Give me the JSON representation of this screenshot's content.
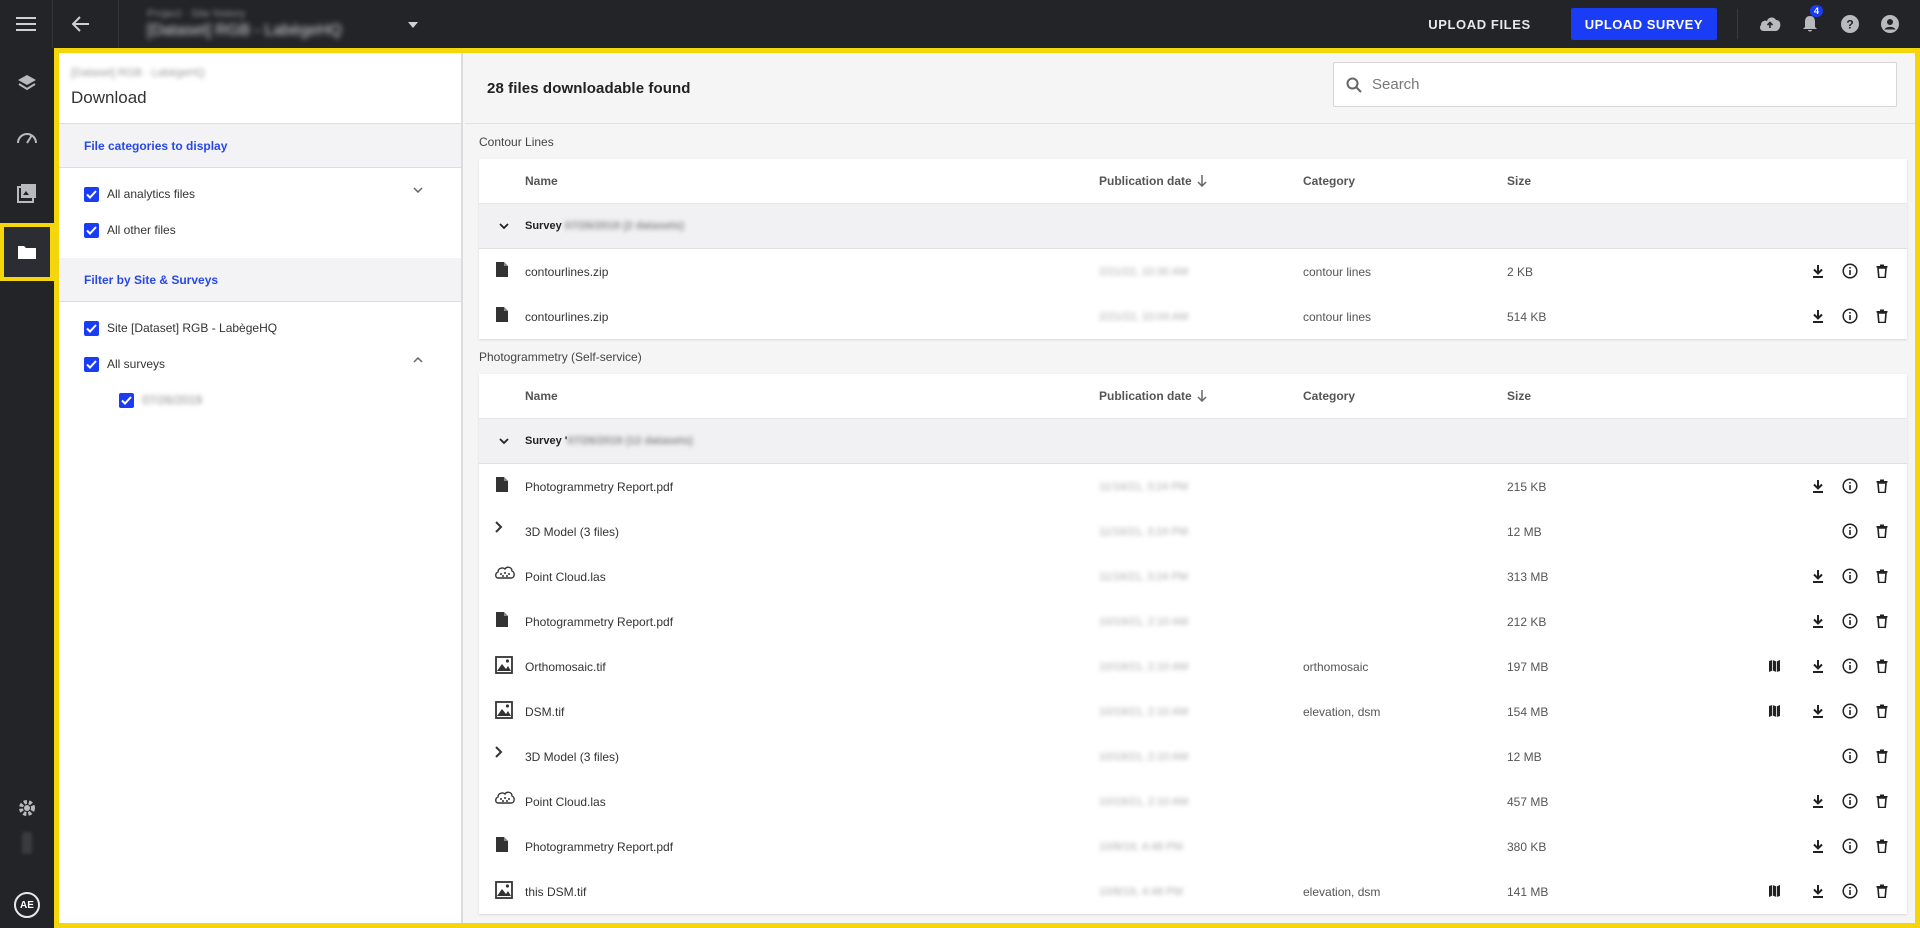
{
  "topbar": {
    "project_sub": "Project · Site history",
    "project_name": "[Dataset] RGB - LabègeHQ",
    "upload_files": "UPLOAD FILES",
    "upload_survey": "UPLOAD SURVEY",
    "notification_count": "4"
  },
  "filters": {
    "breadcrumb": "[Dataset] RGB · LabègeHQ",
    "title": "Download",
    "categories_title": "File categories to display",
    "all_analytics": "All analytics files",
    "all_other": "All other files",
    "site_title": "Filter by Site & Surveys",
    "site_label": "Site [Dataset] RGB - LabègeHQ",
    "all_surveys": "All surveys",
    "survey_date": "07/26/2019"
  },
  "content": {
    "count_label": "28 files downloadable found",
    "search_placeholder": "Search",
    "columns": {
      "name": "Name",
      "publication": "Publication date",
      "category": "Category",
      "size": "Size"
    }
  },
  "sections": [
    {
      "title": "Contour Lines",
      "group_label": "Survey",
      "group_detail": "07/26/2019 (2 datasets)",
      "rows": [
        {
          "name": "contourlines.zip",
          "date": "2/21/22, 10:30 AM",
          "category": "contour lines",
          "size": "2 KB",
          "icon": "file-icon"
        },
        {
          "name": "contourlines.zip",
          "date": "2/21/22, 10:04 AM",
          "category": "contour lines",
          "size": "514 KB",
          "icon": "file-icon"
        }
      ]
    },
    {
      "title": "Photogrammetry (Self-service)",
      "group_label": "Survey '",
      "group_detail": "07/26/2019 (12 datasets)",
      "rows": [
        {
          "name": "Photogrammetry Report.pdf",
          "date": "11/16/21, 3:24 PM",
          "category": "",
          "size": "215 KB",
          "icon": "file-icon"
        },
        {
          "name": "3D Model (3 files)",
          "date": "11/16/21, 3:24 PM",
          "category": "",
          "size": "12 MB",
          "icon": "chevron-right-icon"
        },
        {
          "name": "Point Cloud.las",
          "date": "11/16/21, 3:24 PM",
          "category": "",
          "size": "313 MB",
          "icon": "point-cloud-icon"
        },
        {
          "name": "Photogrammetry Report.pdf",
          "date": "10/19/21, 2:10 AM",
          "category": "",
          "size": "212 KB",
          "icon": "file-icon"
        },
        {
          "name": "Orthomosaic.tif",
          "date": "10/19/21, 2:10 AM",
          "category": "orthomosaic",
          "size": "197 MB",
          "icon": "raster-icon"
        },
        {
          "name": "DSM.tif",
          "date": "10/19/21, 2:10 AM",
          "category": "elevation, dsm",
          "size": "154 MB",
          "icon": "raster-icon"
        },
        {
          "name": "3D Model (3 files)",
          "date": "10/19/21, 2:10 AM",
          "category": "",
          "size": "12 MB",
          "icon": "chevron-right-icon"
        },
        {
          "name": "Point Cloud.las",
          "date": "10/19/21, 2:10 AM",
          "category": "",
          "size": "457 MB",
          "icon": "point-cloud-icon"
        },
        {
          "name": "Photogrammetry Report.pdf",
          "date": "10/8/19, 4:48 PM",
          "category": "",
          "size": "380 KB",
          "icon": "file-icon"
        },
        {
          "name": "this DSM.tif",
          "date": "10/8/19, 4:48 PM",
          "category": "elevation, dsm",
          "size": "141 MB",
          "icon": "raster-icon"
        }
      ]
    }
  ],
  "colors": {
    "accent": "#1a3cf5",
    "highlight": "#f5d60a",
    "dark": "#232428"
  }
}
